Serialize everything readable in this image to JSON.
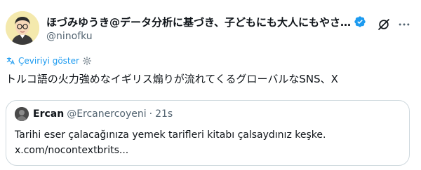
{
  "author": {
    "display_name": "ほづみゆうき@データ分析に基づき、子どもにも大人にもやさ…",
    "handle": "@ninofku",
    "verified": true
  },
  "translate": {
    "label": "Çeviriyi göster"
  },
  "tweet": {
    "text": "トルコ語の火力強めなイギリス煽りが流れてくるグローバルなSNS、X"
  },
  "quote": {
    "name": "Ercan",
    "handle": "@Ercanercoyeni",
    "separator": "·",
    "time": "21s",
    "line1": "Tarihi eser çalacağınıza yemek tarifleri kitabı çalsaydınız keşke.",
    "line2": "x.com/nocontextbrits..."
  },
  "colors": {
    "verified": "#1d9bf0",
    "link": "#1d9bf0",
    "secondary_text": "#536471",
    "border": "#cfd9de"
  },
  "icons": [
    "verified-badge-icon",
    "grok-icon",
    "more-icon",
    "translate-icon"
  ]
}
